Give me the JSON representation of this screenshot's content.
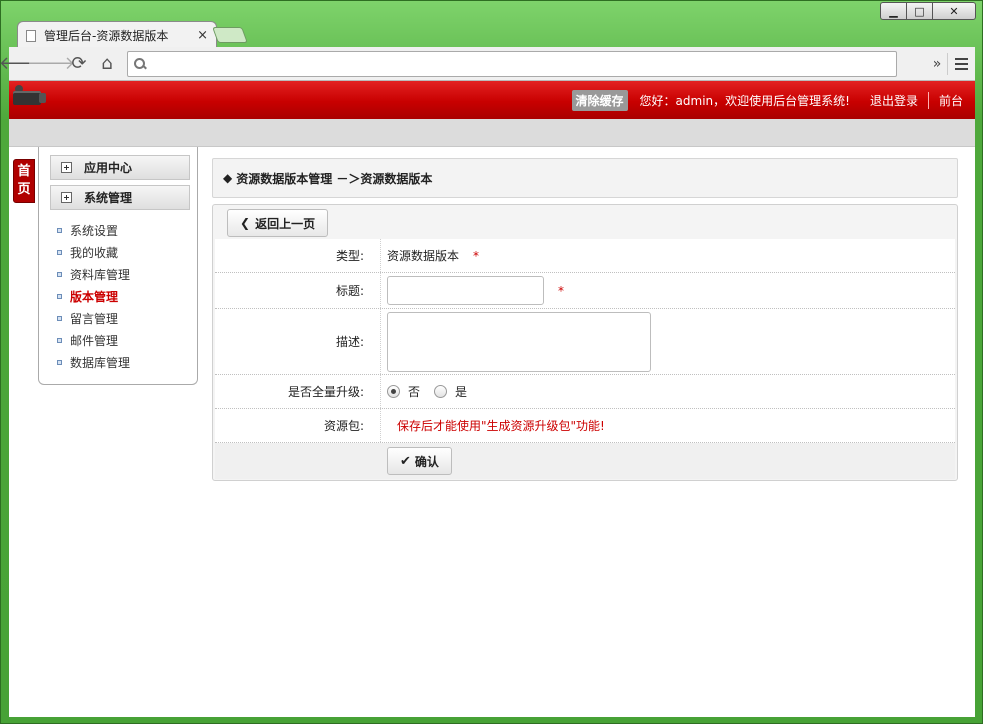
{
  "browser": {
    "tab_title": "管理后台-资源数据版本",
    "tab_close": "×",
    "address_value": "",
    "overflow": "»"
  },
  "header": {
    "clear_cache": "清除缓存",
    "welcome": "您好：admin，欢迎使用后台管理系统!",
    "logout": "退出登录",
    "frontend": "前台"
  },
  "home_tab": "首页",
  "sidebar": {
    "groups": [
      {
        "label": "应用中心"
      },
      {
        "label": "系统管理"
      }
    ],
    "items": [
      {
        "label": "系统设置"
      },
      {
        "label": "我的收藏"
      },
      {
        "label": "资料库管理"
      },
      {
        "label": "版本管理"
      },
      {
        "label": "留言管理"
      },
      {
        "label": "邮件管理"
      },
      {
        "label": "数据库管理"
      }
    ],
    "active_item": "版本管理"
  },
  "breadcrumb": {
    "prefix": "◆",
    "text": "资源数据版本管理 －＞资源数据版本"
  },
  "panel": {
    "back_label": "返回上一页",
    "form": {
      "type_label": "类型:",
      "type_value": "资源数据版本",
      "required_mark": "*",
      "title_label": "标题:",
      "title_value": "",
      "desc_label": "描述:",
      "desc_value": "",
      "upgrade_label": "是否全量升级:",
      "upgrade_options": [
        "否",
        "是"
      ],
      "upgrade_selected": "否",
      "package_label": "资源包:",
      "package_notice": "保存后才能使用\"生成资源升级包\"功能!",
      "confirm_label": "确认"
    }
  },
  "colors": {
    "header_red": "#c80000",
    "accent_red": "#cc0000",
    "window_green": "#4ea83b"
  }
}
